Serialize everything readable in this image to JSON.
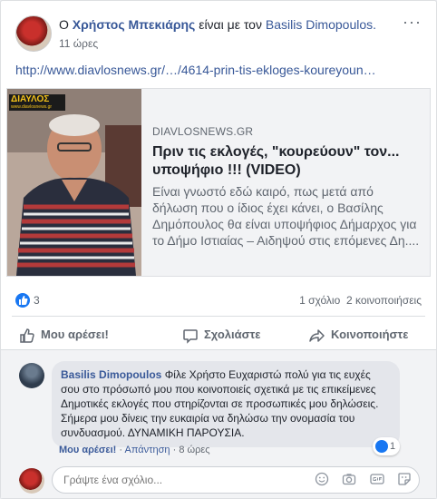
{
  "post": {
    "prefix": "Ο",
    "author": "Χρήστος Μπεκιάρης",
    "with_text": "είναι με τον",
    "tagged": "Basilis Dimopoulos.",
    "time": "11 ώρες",
    "link": "http://www.diavlosnews.gr/…/4614-prin-tis-ekloges-koureyoun…",
    "menu_icon": "more-dots-icon"
  },
  "preview": {
    "logo": "ΔΙΑΥΛΟΣ",
    "logo_sub": "www.diavlosnews.gr",
    "domain": "DIAVLOSNEWS.GR",
    "title": "Πριν τις εκλογές, \"κουρεύουν\" τον... υποψήφιο !!! (VIDEO)",
    "description": "Είναι γνωστό εδώ καιρό, πως μετά από δήλωση που ο ίδιος έχει κάνει, ο Βασίλης Δημόπουλος θα είναι υποψήφιος Δήμαρχος για το Δήμο Ιστιαίας – Αιδηψού στις επόμενες Δη...."
  },
  "stats": {
    "likes": "3",
    "comments": "1 σχόλιο",
    "shares": "2 κοινοποιήσεις"
  },
  "actions": {
    "like": "Μου αρέσει!",
    "comment": "Σχολιάστε",
    "share": "Κοινοποιήστε"
  },
  "comment": {
    "author": "Basilis Dimopoulos",
    "text": "Φίλε Χρήστο Ευχαριστώ πολύ για τις ευχές σου στο πρόσωπό μου που κοινοποιείς σχετικά με τις επικείμενες Δημοτικές εκλογές που στηρίζονται σε προσωπικές μου δηλώσεις. Σήμερα μου δίνεις την ευκαιρία να δηλώσω την ονομασία του συνδυασμού. ΔΥΝΑΜΙΚΗ ΠΑΡΟΥΣΙΑ.",
    "like": "Μου αρέσει!",
    "reply": "Απάντηση",
    "sep": "·",
    "time": "8 ώρες",
    "reaction_count": "1"
  },
  "composer": {
    "placeholder": "Γράψτε ένα σχόλιο..."
  },
  "colors": {
    "link": "#385898",
    "like_blue": "#1877f2",
    "muted": "#606770"
  }
}
